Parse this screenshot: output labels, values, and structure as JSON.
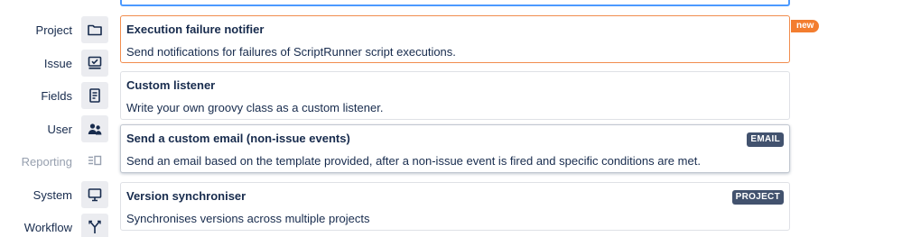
{
  "nav": {
    "items": [
      {
        "label": "Project",
        "icon": "folder-icon",
        "disabled": false
      },
      {
        "label": "Issue",
        "icon": "issue-icon",
        "disabled": false
      },
      {
        "label": "Fields",
        "icon": "document-icon",
        "disabled": false
      },
      {
        "label": "User",
        "icon": "users-icon",
        "disabled": false
      },
      {
        "label": "Reporting",
        "icon": "reporting-icon",
        "disabled": true
      },
      {
        "label": "System",
        "icon": "monitor-icon",
        "disabled": false
      },
      {
        "label": "Workflow",
        "icon": "branch-icon",
        "disabled": false
      }
    ]
  },
  "cards": [
    {
      "title": "Execution failure notifier",
      "description": "Send notifications for failures of ScriptRunner script executions.",
      "badge": "new",
      "tag": ""
    },
    {
      "title": "Custom listener",
      "description": "Write your own groovy class as a custom listener.",
      "badge": "",
      "tag": ""
    },
    {
      "title": "Send a custom email (non-issue events)",
      "description": "Send an email based on the template provided, after a non-issue event is fired and specific conditions are met.",
      "badge": "",
      "tag": "EMAIL"
    },
    {
      "title": "Version synchroniser",
      "description": "Synchronises versions across multiple projects",
      "badge": "",
      "tag": "PROJECT"
    }
  ],
  "colors": {
    "highlight_border": "#f18d4e",
    "new_badge": "#f37d2f",
    "tag_background": "#42526e",
    "search_focus": "#4c9aff"
  }
}
